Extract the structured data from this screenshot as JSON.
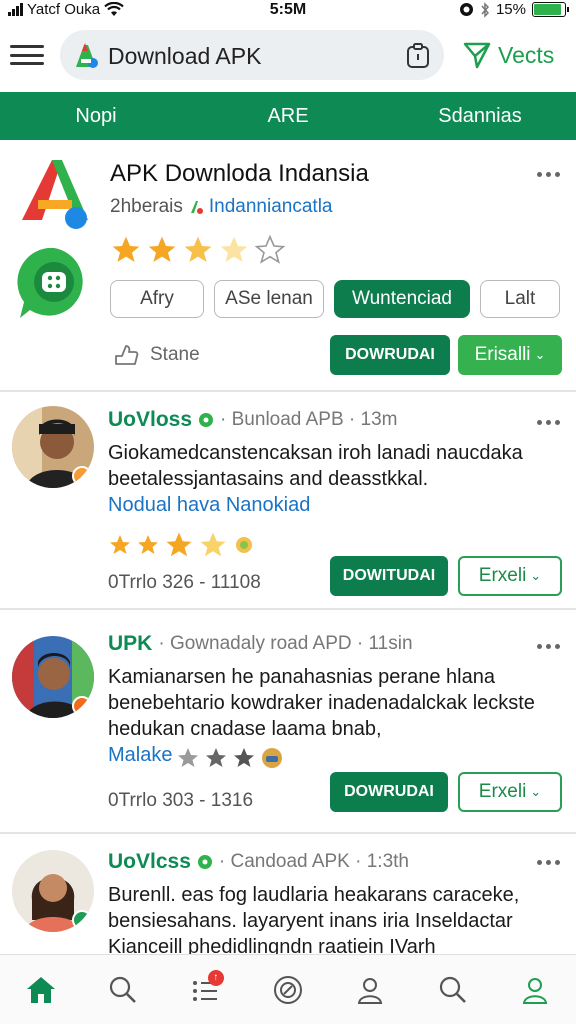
{
  "status_bar": {
    "carrier": "Yatcf Ouka",
    "time": "5:5M",
    "battery": "15%"
  },
  "top_bar": {
    "search_text": "Download APK",
    "verify_label": "Vects"
  },
  "tabs": [
    {
      "label": "Nopi"
    },
    {
      "label": "ARE"
    },
    {
      "label": "Sdannias"
    }
  ],
  "app": {
    "title": "APK Downloda Indansia",
    "subtitle_prefix": "2hberais",
    "subtitle_link": "Indanniancatla",
    "rating": 3,
    "chips": [
      "Afry",
      "ASe lenan",
      "Wuntenciad",
      "Lalt"
    ],
    "share_label": "Stane",
    "download_label": "DOWRUDAI",
    "install_label": "Erisalli"
  },
  "posts": [
    {
      "name": "UoVloss",
      "meta": "· Bunload APB · 13m",
      "body": "Giokamedcanstencaksan iroh lanadi naucdaka beetalessjantasains and deasstkkal.",
      "tag": "Nodual hava Nanokiad",
      "stats": "0Trrlo  326 - 11108",
      "download_label": "DOWITUDAI",
      "extra_label": "Erxeli"
    },
    {
      "name": "UPK",
      "meta": "· Gownadaly road APD · 11sin",
      "body": "Kamianarsen he panahasnias perane hlana benebehtario kowdraker inadenadalckak leckste hedukan cnadase laama bnab,",
      "tag": "Malake",
      "stats": "0Trrlo  303 - 1316",
      "download_label": "DOWRUDAI",
      "extra_label": "Erxeli"
    },
    {
      "name": "UoVlcss",
      "meta": "· Candoad APK · 1:3th",
      "body": "Burenll. eas fog laudlaria heakarans caraceke, bensiesahans. layaryent inans iria Inseldactar Kianceill phedidlingndn raatiein IVarh"
    }
  ],
  "colors": {
    "brand_green": "#0e8a54",
    "accent_green": "#35b14f",
    "link_blue": "#1a73c4",
    "star": "#f5a623"
  }
}
